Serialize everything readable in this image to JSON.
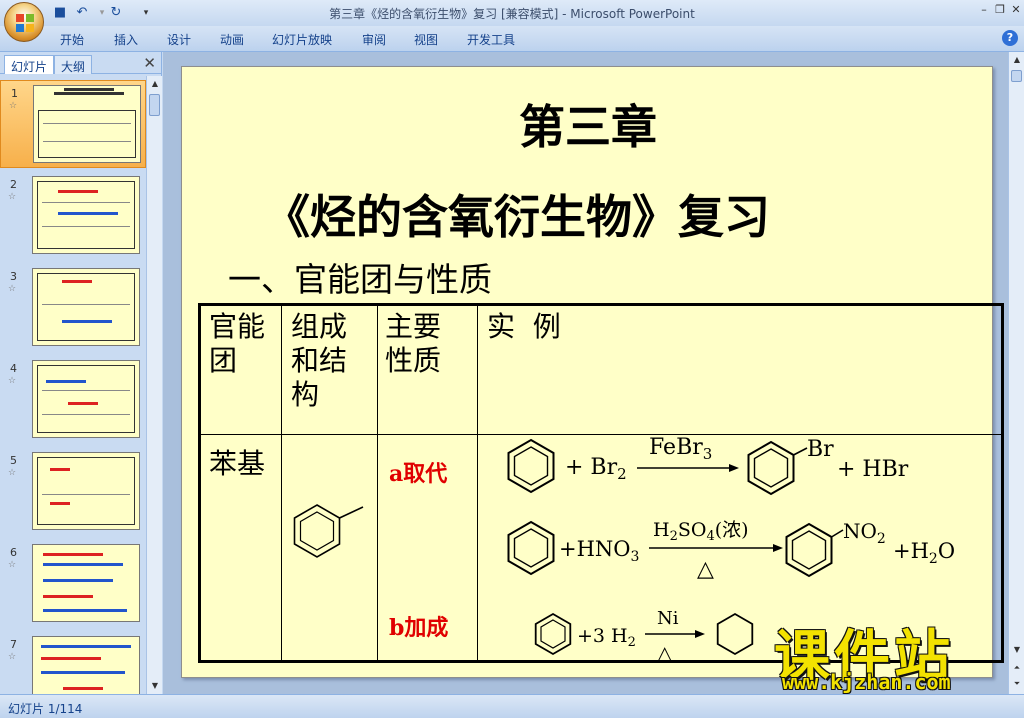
{
  "window": {
    "title": "第三章《烃的含氧衍生物》复习 [兼容模式] - Microsoft PowerPoint"
  },
  "quick_access": {
    "save_icon": "save-icon",
    "undo_icon": "undo-icon",
    "redo_icon": "redo-icon",
    "customize_icon": "dropdown-icon"
  },
  "window_controls": {
    "minimize": "–",
    "restore": "❐",
    "close": "✕"
  },
  "ribbon": {
    "tabs": [
      "开始",
      "插入",
      "设计",
      "动画",
      "幻灯片放映",
      "审阅",
      "视图",
      "开发工具"
    ],
    "help": "?"
  },
  "left_pane": {
    "tab_slides": "幻灯片",
    "tab_outline": "大纲",
    "close": "✕",
    "thumbnails": [
      {
        "num": "1",
        "selected": true
      },
      {
        "num": "2",
        "selected": false
      },
      {
        "num": "3",
        "selected": false
      },
      {
        "num": "4",
        "selected": false
      },
      {
        "num": "5",
        "selected": false
      },
      {
        "num": "6",
        "selected": false
      },
      {
        "num": "7",
        "selected": false
      }
    ]
  },
  "slide": {
    "chapter": "第三章",
    "subtitle": "《烃的含氧衍生物》复习",
    "section": "一、官能团与性质",
    "table": {
      "headers": [
        "官能\n团",
        "组成\n和结\n构",
        "主要\n性质",
        "实  例"
      ],
      "row_name": "苯基",
      "prop_a": "a取代",
      "prop_b": "b加成",
      "reactions": {
        "r1_plus": "+ Br",
        "r1_sub": "2",
        "r1_catalyst": "FeBr",
        "r1_catalyst_sub": "3",
        "r1_sub_group": "Br",
        "r1_product": "+ HBr",
        "r2_reagent": "+HNO",
        "r2_reagent_sub": "3",
        "r2_catalyst": "H",
        "r2_catalyst_sub": "2",
        "r2_catalyst_rest": "SO",
        "r2_catalyst_sub2": "4",
        "r2_catalyst_tail": "(浓)",
        "r2_group": "NO",
        "r2_group_sub": "2",
        "r2_product": "+H",
        "r2_product_sub": "2",
        "r2_product_tail": "O",
        "r3_reagent": "+3 H",
        "r3_reagent_sub": "2",
        "r3_catalyst": "Ni",
        "heat": "△"
      }
    }
  },
  "watermark": {
    "text": "课件站",
    "url": "www.kjzhan.com"
  },
  "status_bar": {
    "slide_counter": "幻灯片 1/114"
  }
}
